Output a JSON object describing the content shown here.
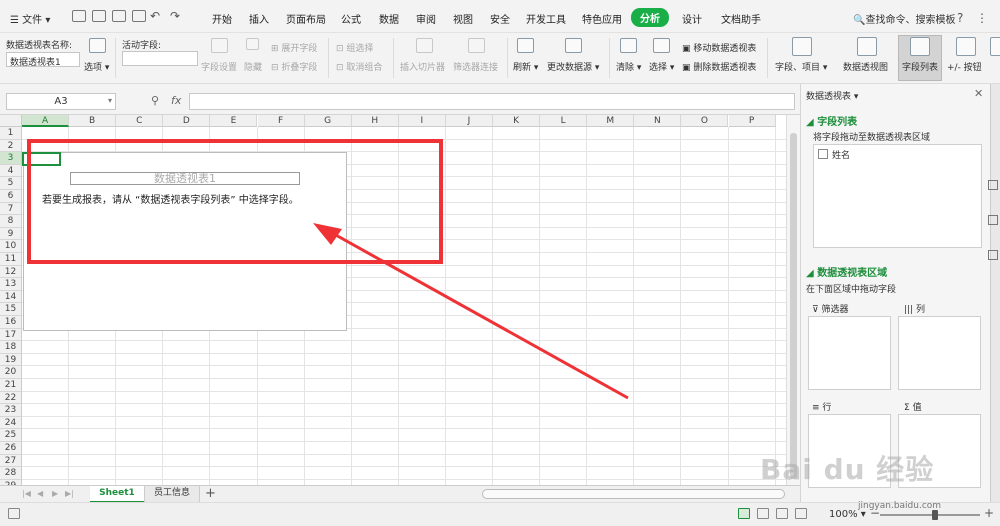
{
  "menubar": {
    "file": "文件",
    "tabs": [
      "开始",
      "插入",
      "页面布局",
      "公式",
      "数据",
      "审阅",
      "视图",
      "安全",
      "开发工具",
      "特色应用",
      "分析",
      "设计",
      "文档助手"
    ],
    "search": "查找命令、搜索模板",
    "help": "?"
  },
  "ribbon": {
    "pivot_name_label": "数据透视表名称:",
    "pivot_name_value": "数据透视表1",
    "options": "选项",
    "active_field_label": "活动字段:",
    "field_settings": "字段设置",
    "hide": "隐藏",
    "expand": "展开字段",
    "collapse": "折叠字段",
    "group_selection": "组选择",
    "ungroup": "取消组合",
    "insert_slicer": "插入切片器",
    "filter_connection": "筛选器连接",
    "refresh": "刷新",
    "change_source": "更改数据源",
    "clear": "清除",
    "select": "选择",
    "move_pivot": "移动数据透视表",
    "delete_pivot": "删除数据透视表",
    "fields_items": "字段、项目",
    "pivot_chart": "数据透视图",
    "field_list": "字段列表",
    "plus_minus": "+/- 按钮"
  },
  "formula_bar": {
    "cell_ref": "A3",
    "fx": "fx"
  },
  "sheet": {
    "columns": [
      "A",
      "B",
      "C",
      "D",
      "E",
      "F",
      "G",
      "H",
      "I",
      "J",
      "K",
      "L",
      "M",
      "N",
      "O",
      "P"
    ],
    "rows": [
      "1",
      "2",
      "3",
      "4",
      "5",
      "6",
      "7",
      "8",
      "9",
      "10",
      "11",
      "12",
      "13",
      "14",
      "15",
      "16",
      "17",
      "18",
      "19",
      "20",
      "21",
      "22",
      "23",
      "24",
      "25",
      "26",
      "27",
      "28",
      "29"
    ],
    "pivot_title": "数据透视表1",
    "pivot_hint": "若要生成报表，请从 “数据透视表字段列表” 中选择字段。"
  },
  "sheet_tabs": {
    "tabs": [
      "Sheet1",
      "员工信息"
    ],
    "add": "+"
  },
  "status": {
    "zoom": "100%"
  },
  "panel": {
    "title": "数据透视表",
    "field_list_header": "字段列表",
    "field_list_desc": "将字段拖动至数据透视表区域",
    "fields": [
      "姓名"
    ],
    "area_header": "数据透视表区域",
    "area_desc": "在下面区域中拖动字段",
    "filter": "筛选器",
    "columns": "列",
    "rows": "行",
    "values": "值"
  },
  "watermark": {
    "main": "Bai du 经验",
    "sub": "jingyan.baidu.com"
  },
  "colors": {
    "accent": "#1aae49",
    "annotation": "#ef3236"
  }
}
